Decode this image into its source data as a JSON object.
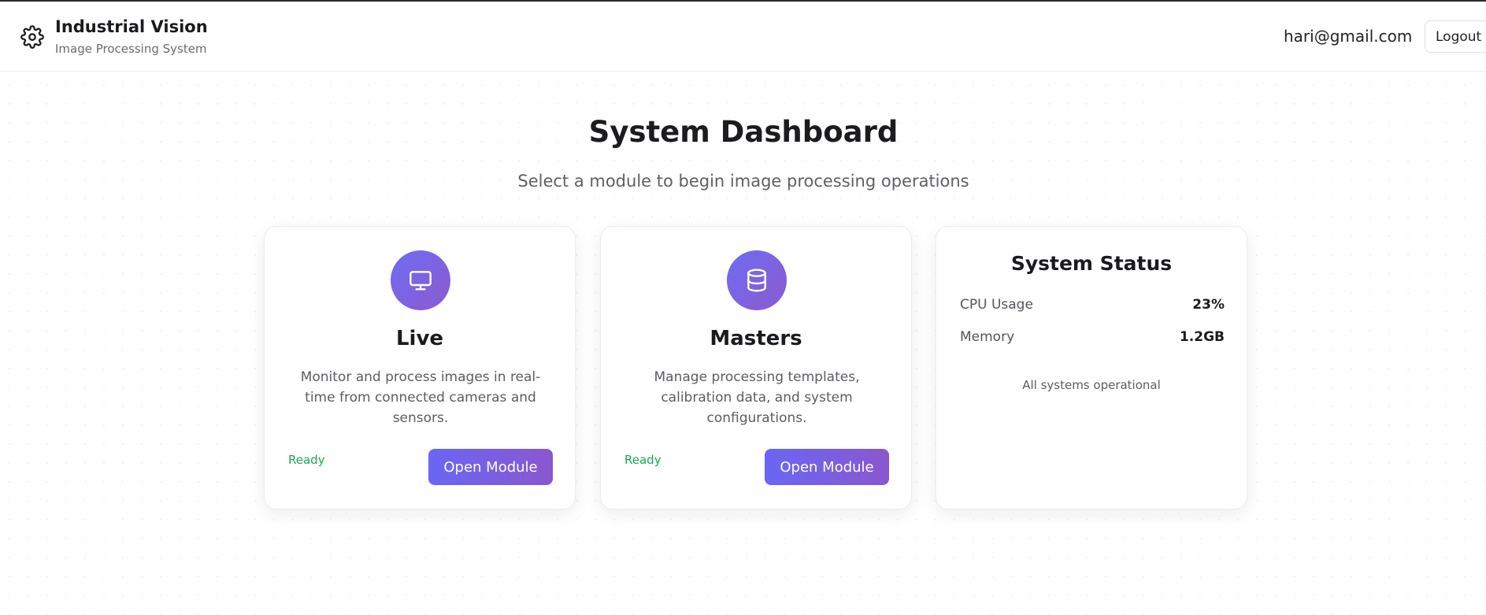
{
  "header": {
    "app_title": "Industrial Vision",
    "app_subtitle": "Image Processing System",
    "brand_icon": "gear-icon",
    "user_email": "hari@gmail.com",
    "logout_label": "Logout"
  },
  "main": {
    "title": "System Dashboard",
    "subtitle": "Select a module to begin image processing operations"
  },
  "modules": [
    {
      "title": "Live",
      "icon": "monitor-icon",
      "description": "Monitor and process images in real-time from connected cameras and sensors.",
      "status": "Ready",
      "button_label": "Open Module"
    },
    {
      "title": "Masters",
      "icon": "database-icon",
      "description": "Manage processing templates, calibration data, and system configurations.",
      "status": "Ready",
      "button_label": "Open Module"
    }
  ],
  "system_status": {
    "title": "System Status",
    "metrics": [
      {
        "label": "CPU Usage",
        "value": "23%"
      },
      {
        "label": "Memory",
        "value": "1.2GB"
      }
    ],
    "note": "All systems operational"
  },
  "colors": {
    "accent_start": "#6a66f5",
    "accent_end": "#8a57cf",
    "ready": "#19a84e"
  }
}
